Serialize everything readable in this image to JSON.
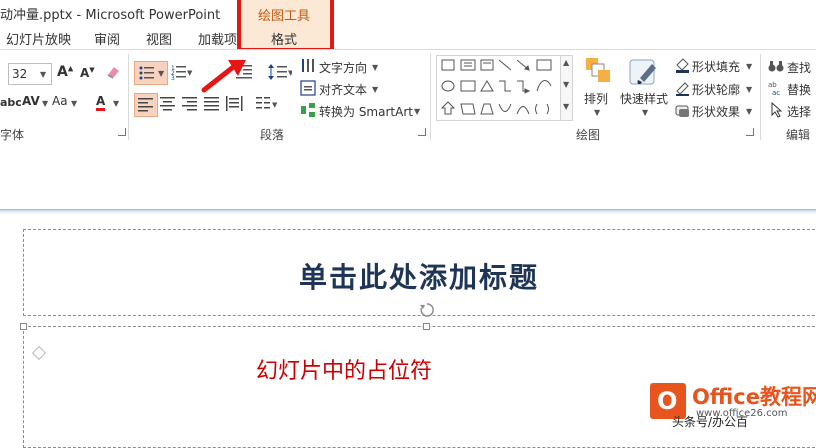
{
  "titlebar": {
    "title": "动冲量.pptx - Microsoft PowerPoint"
  },
  "context_tab": {
    "group": "绘图工具",
    "tab": "格式"
  },
  "tabs": [
    "幻灯片放映",
    "审阅",
    "视图",
    "加载项"
  ],
  "font_group": {
    "size": "32",
    "label": "字体",
    "grow_icon": "font-grow-icon",
    "shrink_icon": "font-shrink-icon",
    "clear_icon": "clear-format-icon",
    "spacing_label": "AV",
    "case_label": "Aa",
    "color_label": "A"
  },
  "paragraph_group": {
    "label": "段落",
    "text_direction": "文字方向",
    "align_text": "对齐文本",
    "smartart": "转换为 SmartArt"
  },
  "drawing_group": {
    "label": "绘图",
    "arrange": "排列",
    "quick_styles": "快速样式",
    "shape_fill": "形状填充",
    "shape_outline": "形状轮廓",
    "shape_effects": "形状效果"
  },
  "editing_group": {
    "label": "编辑",
    "find": "查找",
    "replace": "替换",
    "select": "选择"
  },
  "slide": {
    "title_placeholder": "单击此处添加标题",
    "body_text": "幻灯片中的占位符"
  },
  "watermark": {
    "brand": "Office教程网",
    "url": "www.office26.com",
    "corner": "头条号/办公百"
  },
  "colors": {
    "accent_red": "#e81515",
    "context_orange": "#c55a11",
    "title_navy": "#1f3556",
    "body_red": "#cc0000",
    "brand": "#e8541d"
  }
}
